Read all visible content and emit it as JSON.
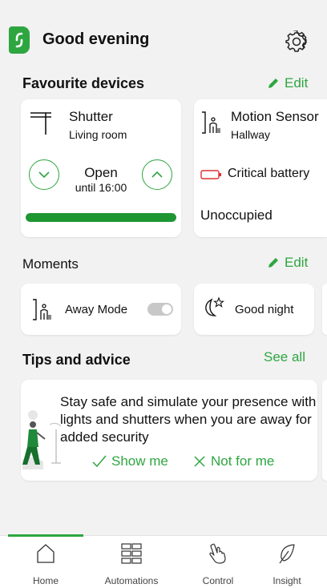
{
  "header": {
    "greeting": "Good evening"
  },
  "favourites": {
    "title": "Favourite devices",
    "edit_label": "Edit",
    "devices": [
      {
        "name": "Shutter",
        "room": "Living room",
        "state": "Open",
        "state_detail": "until 16:00",
        "progress": 1.0
      },
      {
        "name": "Motion Sensor",
        "room": "Hallway",
        "battery": "Critical battery",
        "status": "Unoccupied"
      }
    ]
  },
  "moments": {
    "title": "Moments",
    "edit_label": "Edit",
    "items": [
      {
        "label": "Away Mode",
        "toggle_on": false
      },
      {
        "label": "Good night"
      }
    ]
  },
  "tips": {
    "title": "Tips and advice",
    "see_all": "See all",
    "card": {
      "text": "Stay safe and simulate your presence with lights and shutters when you are away for added security",
      "show_me": "Show me",
      "not_for_me": "Not for me"
    }
  },
  "tabbar": {
    "tabs": [
      {
        "label": "Home",
        "icon": "home-icon",
        "active": true
      },
      {
        "label": "Automations",
        "icon": "grid-icon"
      },
      {
        "label": "Control",
        "icon": "hand-icon"
      },
      {
        "label": "Insight",
        "icon": "leaf-icon"
      }
    ]
  },
  "colors": {
    "accent": "#2ea640",
    "battery": "#e03030",
    "background": "#f2f2f2"
  }
}
